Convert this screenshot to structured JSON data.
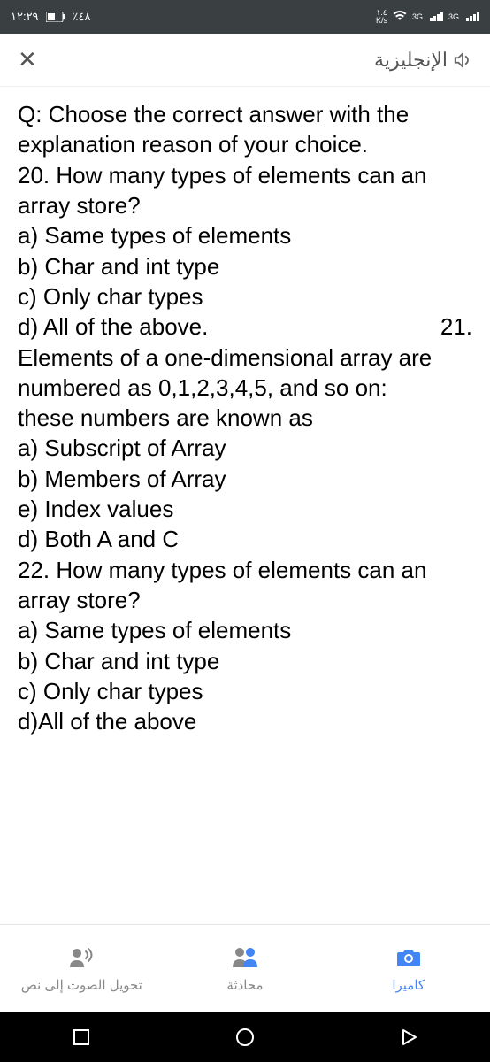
{
  "status": {
    "time": "١٢:٢٩",
    "battery": "٪٤٨",
    "speed_value": "١.٤",
    "speed_unit": "K/s",
    "signal1": "3G",
    "signal2": "3G"
  },
  "header": {
    "language": "الإنجليزية"
  },
  "content": {
    "intro": "Q: Choose the correct answer with the explanation reason of your choice.",
    "q20": "20. How many types of elements can an array store?",
    "q20a": "a) Same types of elements",
    "q20b": "b) Char and int type",
    "q20c": "c) Only char types",
    "q20d": "d) All of the above.",
    "q21num": "21.",
    "q21_1": "Elements of a one-dimensional array are numbered as 0,1,2,3,4,5, and so on:",
    "q21_2": "these numbers are known as",
    "q21a": "a) Subscript of Array",
    "q21b": "b) Members of Array",
    "q21e": "e) Index values",
    "q21d": "d) Both A and C",
    "q22": "22. How many types of elements can an array store?",
    "q22a": "a) Same types of elements",
    "q22b": "b) Char and int type",
    "q22c": "c) Only char types",
    "q22d": "d)All of the above"
  },
  "tabs": {
    "voice": "تحويل الصوت إلى نص",
    "chat": "محادثة",
    "camera": "كاميرا"
  }
}
